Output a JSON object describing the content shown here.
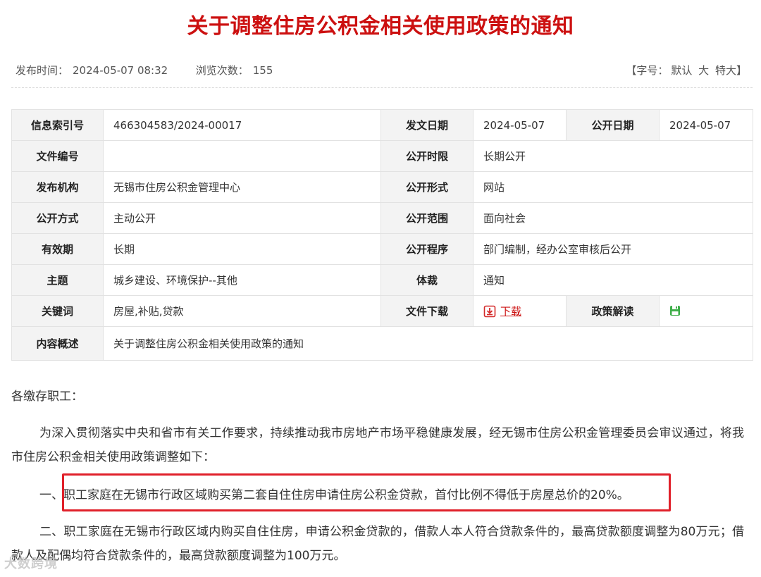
{
  "title": "关于调整住房公积金相关使用政策的通知",
  "meta": {
    "publish_label": "发布时间：",
    "publish_time": "2024-05-07 08:32",
    "views_label": "浏览次数：",
    "views": "155",
    "font_prefix": "【字号：",
    "font_default": "默认",
    "font_large": "大",
    "font_xlarge": "特大",
    "font_suffix": "】"
  },
  "info": {
    "index_no_label": "信息索引号",
    "index_no": "466304583/2024-00017",
    "issue_date_label": "发文日期",
    "issue_date": "2024-05-07",
    "publish_date_label": "公开日期",
    "publish_date": "2024-05-07",
    "doc_no_label": "文件编号",
    "doc_no": "",
    "period_label": "公开时限",
    "period": "长期公开",
    "agency_label": "发布机构",
    "agency": "无锡市住房公积金管理中心",
    "form_label": "公开形式",
    "form": "网站",
    "method_label": "公开方式",
    "method": "主动公开",
    "scope_label": "公开范围",
    "scope": "面向社会",
    "validity_label": "有效期",
    "validity": "长期",
    "procedure_label": "公开程序",
    "procedure": "部门编制，经办公室审核后公开",
    "topic_label": "主题",
    "topic": "城乡建设、环境保护--其他",
    "genre_label": "体裁",
    "genre": "通知",
    "keywords_label": "关键词",
    "keywords": "房屋,补贴,贷款",
    "download_label": "文件下载",
    "download_link": "下载",
    "interpretation_label": "政策解读",
    "summary_label": "内容概述",
    "summary": "关于调整住房公积金相关使用政策的通知"
  },
  "body": {
    "salutation": "各缴存职工：",
    "p1": "为深入贯彻落实中央和省市有关工作要求，持续推动我市房地产市场平稳健康发展，经无锡市住房公积金管理委员会审议通过，将我市住房公积金相关使用政策调整如下：",
    "p2": "一、职工家庭在无锡市行政区域购买第二套自住住房申请住房公积金贷款，首付比例不得低于房屋总价的20%。",
    "p3": "二、职工家庭在无锡市行政区域内购买自住住房，申请公积金贷款的，借款人本人符合贷款条件的，最高贷款额度调整为80万元；借款人及配偶均符合贷款条件的，最高贷款额度调整为100万元。"
  },
  "watermark": "大数跨境",
  "colors": {
    "title_red": "#cc1010",
    "highlight_red": "#e0202a",
    "label_bg": "#f3f3f3",
    "border": "#e2e2e2"
  }
}
